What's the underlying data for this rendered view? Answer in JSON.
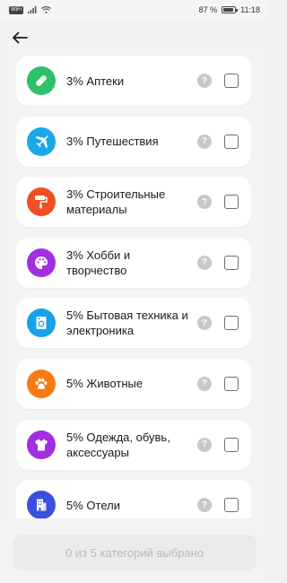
{
  "status_bar": {
    "network_badge": "WiFi",
    "battery_text": "87 %",
    "battery_level": 0.87,
    "time": "11:18"
  },
  "header": {
    "back_icon": "arrow-left-icon"
  },
  "categories": [
    {
      "label": "3% Аптеки",
      "icon": "pill-icon",
      "color": "#2fc16a",
      "checked": false
    },
    {
      "label": "3% Путешествия",
      "icon": "airplane-icon",
      "color": "#1aa7e8",
      "checked": false
    },
    {
      "label": "3% Строительные материалы",
      "icon": "paint-roller-icon",
      "color": "#f04e23",
      "checked": false
    },
    {
      "label": "3% Хобби и творчество",
      "icon": "palette-icon",
      "color": "#a12ee0",
      "checked": false
    },
    {
      "label": "5% Бытовая техника и электроника",
      "icon": "washing-machine-icon",
      "color": "#16a1e8",
      "checked": false
    },
    {
      "label": "5% Животные",
      "icon": "paw-icon",
      "color": "#f57b14",
      "checked": false
    },
    {
      "label": "5% Одежда, обувь, аксессуары",
      "icon": "tshirt-icon",
      "color": "#a12ee0",
      "checked": false
    },
    {
      "label": "5% Отели",
      "icon": "hotel-icon",
      "color": "#3a4ee0",
      "checked": false
    }
  ],
  "help_glyph": "?",
  "footer": {
    "button_label": "0 из 5 категорий выбрано"
  }
}
